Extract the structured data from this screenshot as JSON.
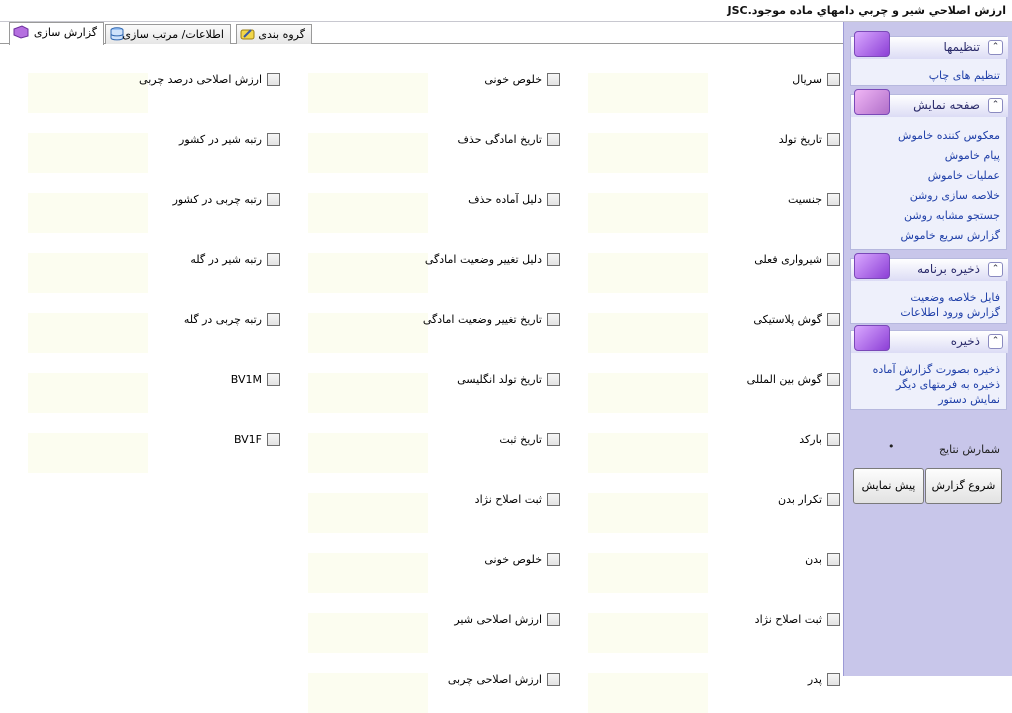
{
  "window": {
    "title": "ارزش اصلاحي شير و چربي  دامهاي ماده موجود.JSC"
  },
  "tabs": [
    {
      "label": "گزارش سازی",
      "icon": "report-icon"
    },
    {
      "label": "اطلاعات/ مرتب سازی",
      "icon": "database-icon"
    },
    {
      "label": "گروه بندی",
      "icon": "group-icon"
    }
  ],
  "fields": {
    "col1": [
      "سريال",
      "تاريخ تولد",
      "جنسيت",
      "شيروارى فعلى",
      "گوش پلاستيكى",
      "گوش بين المللى",
      "باركد",
      "تكرار بدن",
      "بدن",
      "ثبت اصلاح نژاد",
      "پدر"
    ],
    "col2": [
      "خلوص خونى",
      "تاريخ امادگى حذف",
      "دليل آماده حذف",
      "دليل تغيير وضعيت  امادگى",
      "تاريخ تغيير وضعيت  امادگى",
      "تاريخ تولد انگليسى",
      "تاريخ ثبت",
      "ثبت اصلاح نژاد",
      "خلوص خونى",
      "ارزش اصلاحى شير",
      "ارزش اصلاحى چربى"
    ],
    "col3": [
      "ارزش اصلاحى درصد چربى",
      "رتبه شير در كشور",
      "رتبه چربى در كشور",
      "رتبه شير در گله",
      "رتبه چربى در گله",
      "BV1M",
      "BV1F"
    ]
  },
  "sidebar": {
    "settings": {
      "title": "تنظيمها",
      "items": [
        "تنظيم هاى چاپ"
      ]
    },
    "display": {
      "title": "صفحه نمايش",
      "items": [
        "معكوس كننده خاموش",
        "پيام خاموش",
        "عمليات خاموش",
        "خلاصه سازى روشن",
        "جستجو مشابه روشن",
        "گزارش سريع خاموش"
      ]
    },
    "program_save": {
      "title": "ذخيره برنامه",
      "items": [
        "فايل خلاصه وضعيت",
        "گزارش ورود اطلاعات"
      ]
    },
    "save": {
      "title": "ذخيره",
      "items": [
        "ذخيره بصورت گزارش آماده",
        "ذخيره به فرمتهاى ديگر",
        "نمايش دستور"
      ]
    },
    "result_count_label": "شمارش نتايج",
    "result_count_value": "•",
    "buttons": {
      "start": "شروع گزارش",
      "preview": "پيش نمايش"
    }
  }
}
